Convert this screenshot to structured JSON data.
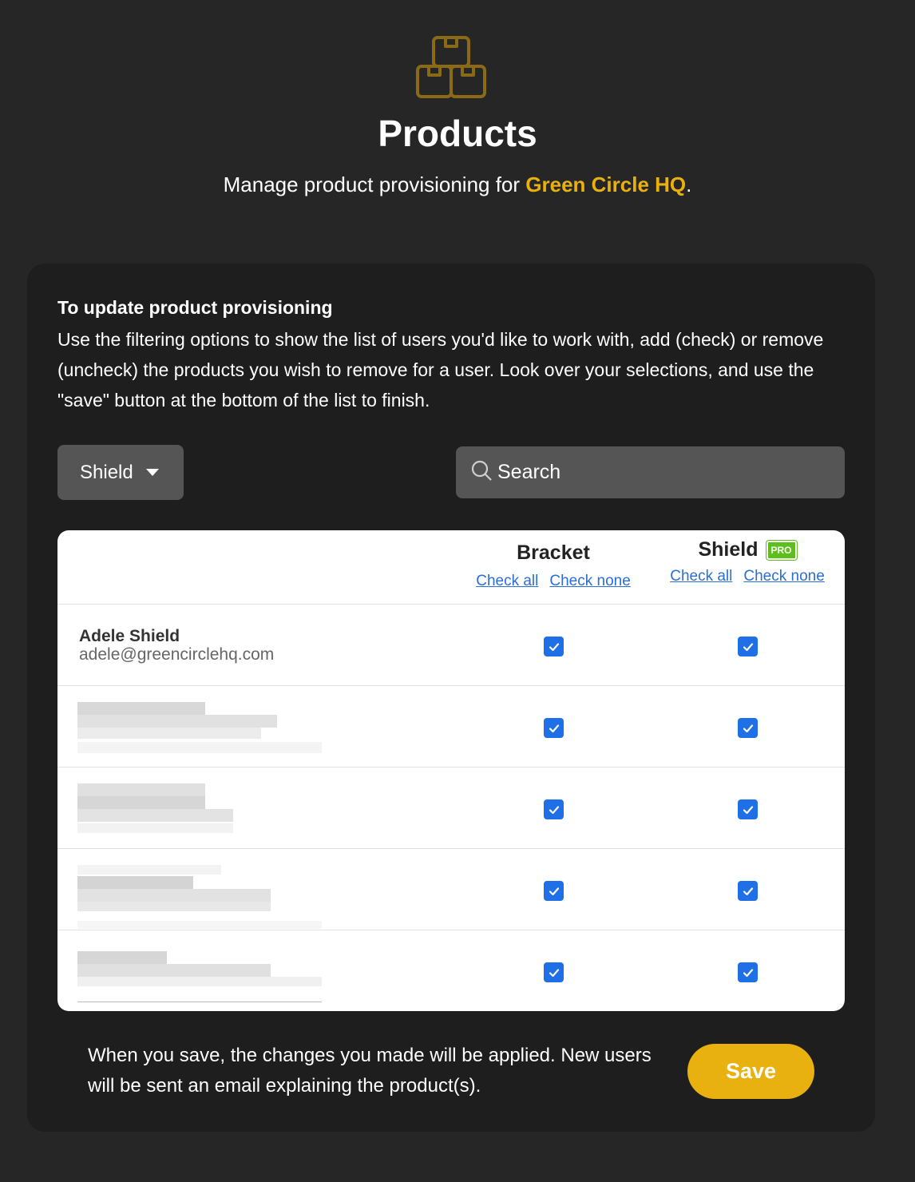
{
  "header": {
    "logo_icon": "boxes-icon",
    "title": "Products",
    "subtitle_prefix": "Manage product provisioning for ",
    "org_name": "Green Circle HQ",
    "subtitle_suffix": "."
  },
  "instructions": {
    "heading": "To update product provisioning",
    "body": "Use the filtering options to show the list of users you'd like to work with, add (check) or remove (uncheck) the products you wish to remove for a user. Look over your selections, and use the \"save\" button at the bottom of the list to finish."
  },
  "filters": {
    "product_select": "Shield",
    "search_placeholder": "Search"
  },
  "table": {
    "columns": [
      {
        "name": "Bracket",
        "badge": "",
        "check_all": "Check all",
        "check_none": "Check none"
      },
      {
        "name": "Shield",
        "badge": "PRO",
        "check_all": "Check all",
        "check_none": "Check none"
      }
    ],
    "rows": [
      {
        "name": "Adele Shield",
        "email": "adele@greencirclehq.com",
        "bracket": true,
        "shield": true
      },
      {
        "name": "",
        "email": "",
        "redacted": true,
        "bracket": true,
        "shield": true
      },
      {
        "name": "",
        "email": "",
        "redacted": true,
        "bracket": true,
        "shield": true
      },
      {
        "name": "",
        "email": "",
        "redacted": true,
        "bracket": true,
        "shield": true
      },
      {
        "name": "",
        "email": "",
        "redacted": true,
        "bracket": true,
        "shield": true
      }
    ]
  },
  "footer": {
    "note": "When you save, the changes you made will be applied. New users will be sent an email explaining the product(s).",
    "save_label": "Save"
  },
  "colors": {
    "accent": "#e8b10f",
    "checkbox": "#1f6fe6",
    "link": "#2a6fd6",
    "pro_badge": "#5cbf1a"
  }
}
